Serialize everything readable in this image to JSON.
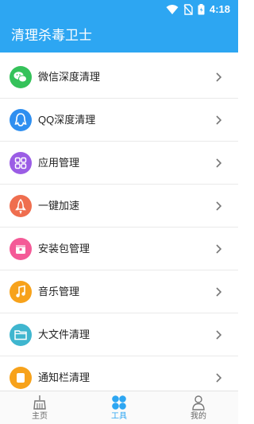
{
  "status_bar": {
    "time": "4:18"
  },
  "app_bar": {
    "title": "清理杀毒卫士"
  },
  "list": {
    "items": [
      {
        "label": "微信深度清理",
        "icon": "wechat-icon",
        "color": "#35c25a"
      },
      {
        "label": "QQ深度清理",
        "icon": "qq-icon",
        "color": "#2f8ff0"
      },
      {
        "label": "应用管理",
        "icon": "apps-grid-icon",
        "color": "#9b5de5"
      },
      {
        "label": "一键加速",
        "icon": "rocket-icon",
        "color": "#ef6e4f"
      },
      {
        "label": "安装包管理",
        "icon": "package-icon",
        "color": "#f45a97"
      },
      {
        "label": "音乐管理",
        "icon": "music-icon",
        "color": "#f7a21b"
      },
      {
        "label": "大文件清理",
        "icon": "folder-icon",
        "color": "#3fb6cf"
      },
      {
        "label": "通知栏清理",
        "icon": "notification-icon",
        "color": "#f7a21b"
      }
    ]
  },
  "bottom_nav": {
    "items": [
      {
        "label": "主页",
        "icon": "home-broom-icon",
        "active": false
      },
      {
        "label": "工具",
        "icon": "tools-icon",
        "active": true
      },
      {
        "label": "我的",
        "icon": "profile-icon",
        "active": false
      }
    ]
  },
  "colors": {
    "primary": "#2da6f2",
    "divider": "#e9e9e9",
    "chevron": "#777777"
  }
}
